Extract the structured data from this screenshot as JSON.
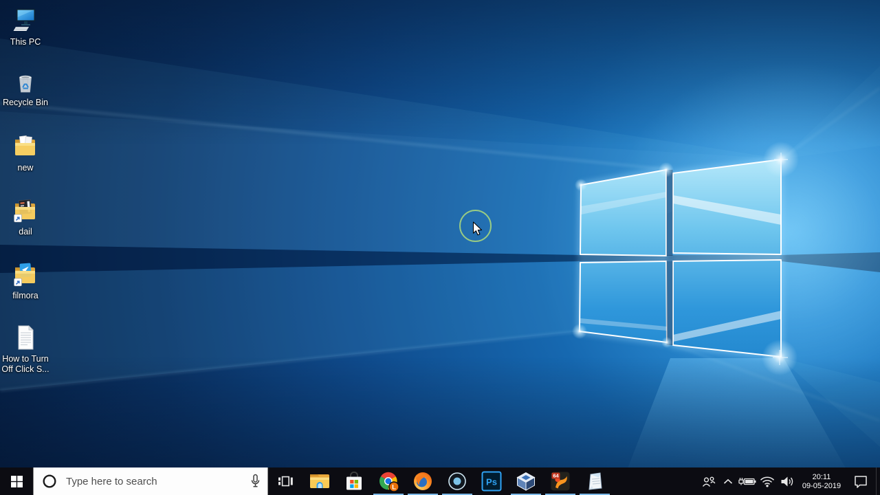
{
  "wallpaper": {
    "name": "windows-10-hero",
    "base_color": "#0a2a52",
    "logo_glow_color": "#bfe9ff"
  },
  "desktop": {
    "icons": [
      {
        "name": "this-pc",
        "label": "This PC"
      },
      {
        "name": "recycle-bin",
        "label": "Recycle Bin"
      },
      {
        "name": "new",
        "label": "new"
      },
      {
        "name": "dail",
        "label": "dail"
      },
      {
        "name": "filmora",
        "label": "filmora"
      },
      {
        "name": "how-to-doc",
        "label": "How to Turn Off Click S..."
      }
    ]
  },
  "cursor": {
    "highlight_color": "#a3d380"
  },
  "taskbar": {
    "background": "#0c0c12",
    "running_indicator_color": "#7cb9e8",
    "search": {
      "placeholder": "Type here to search"
    },
    "apps": [
      {
        "name": "task-view",
        "running": false
      },
      {
        "name": "file-explorer",
        "running": false
      },
      {
        "name": "microsoft-store",
        "running": false
      },
      {
        "name": "chrome",
        "running": true,
        "badge": "L"
      },
      {
        "name": "firefox",
        "running": true
      },
      {
        "name": "screen-recorder",
        "running": true
      },
      {
        "name": "photoshop",
        "running": false,
        "label": "Ps"
      },
      {
        "name": "virtualbox",
        "running": true
      },
      {
        "name": "app-64bit",
        "running": true,
        "badge": "64"
      },
      {
        "name": "notepad",
        "running": true
      }
    ],
    "tray": {
      "time": "20:11",
      "date": "09-05-2019"
    }
  }
}
